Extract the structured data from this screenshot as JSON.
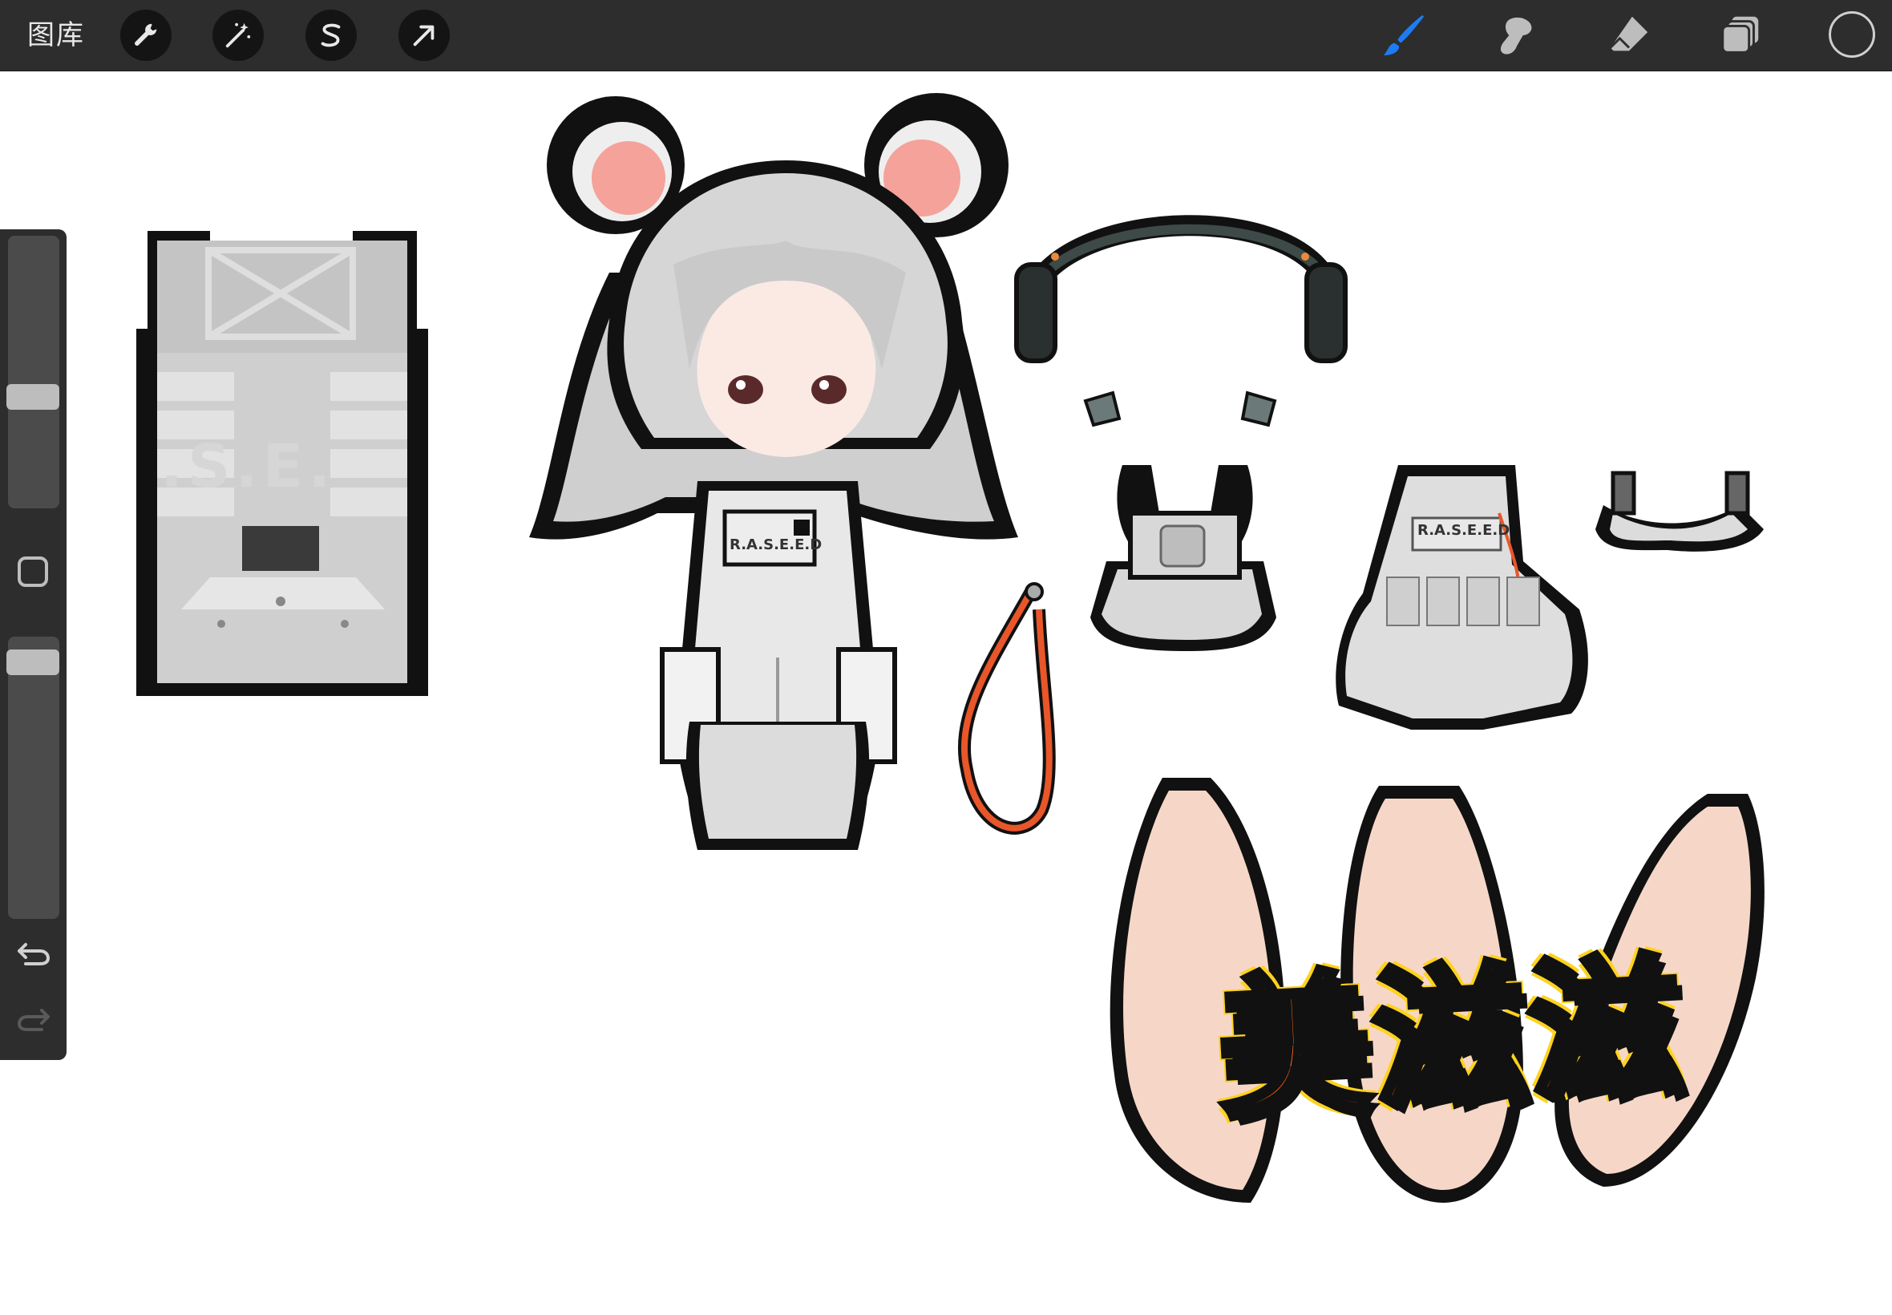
{
  "topbar": {
    "gallery_label": "图库",
    "tools_left": [
      {
        "name": "actions",
        "icon": "wrench-icon"
      },
      {
        "name": "adjustments",
        "icon": "magic-wand-icon"
      },
      {
        "name": "selection",
        "icon": "selection-s-icon"
      },
      {
        "name": "transform",
        "icon": "transform-arrow-icon"
      }
    ],
    "tools_right": [
      {
        "name": "brush",
        "icon": "brush-icon",
        "active": true,
        "color": "#1e7cf2"
      },
      {
        "name": "smudge",
        "icon": "smudge-icon"
      },
      {
        "name": "eraser",
        "icon": "eraser-icon"
      },
      {
        "name": "layers",
        "icon": "layers-icon"
      }
    ],
    "current_color": "#2d2d2d"
  },
  "sidebar": {
    "brush_size_level": 0.4,
    "opacity_level": 0.05,
    "modify_icon": "square-icon",
    "undo_icon": "undo-icon",
    "redo_icon": "redo-icon"
  },
  "canvas": {
    "panel_label": ".S.E.",
    "badge_label": "R.A.S.E.E.D",
    "vest_label": "R.A.S.E.E.D",
    "logo_text": "美滋滋",
    "colors": {
      "hair": "#c9c9c9",
      "ear_inner": "#f4a29a",
      "lanyard": "#e8562a",
      "skin": "#f6d7c7",
      "logo_fill": "#ff6a1a",
      "logo_glow": "#ffd21f"
    }
  }
}
